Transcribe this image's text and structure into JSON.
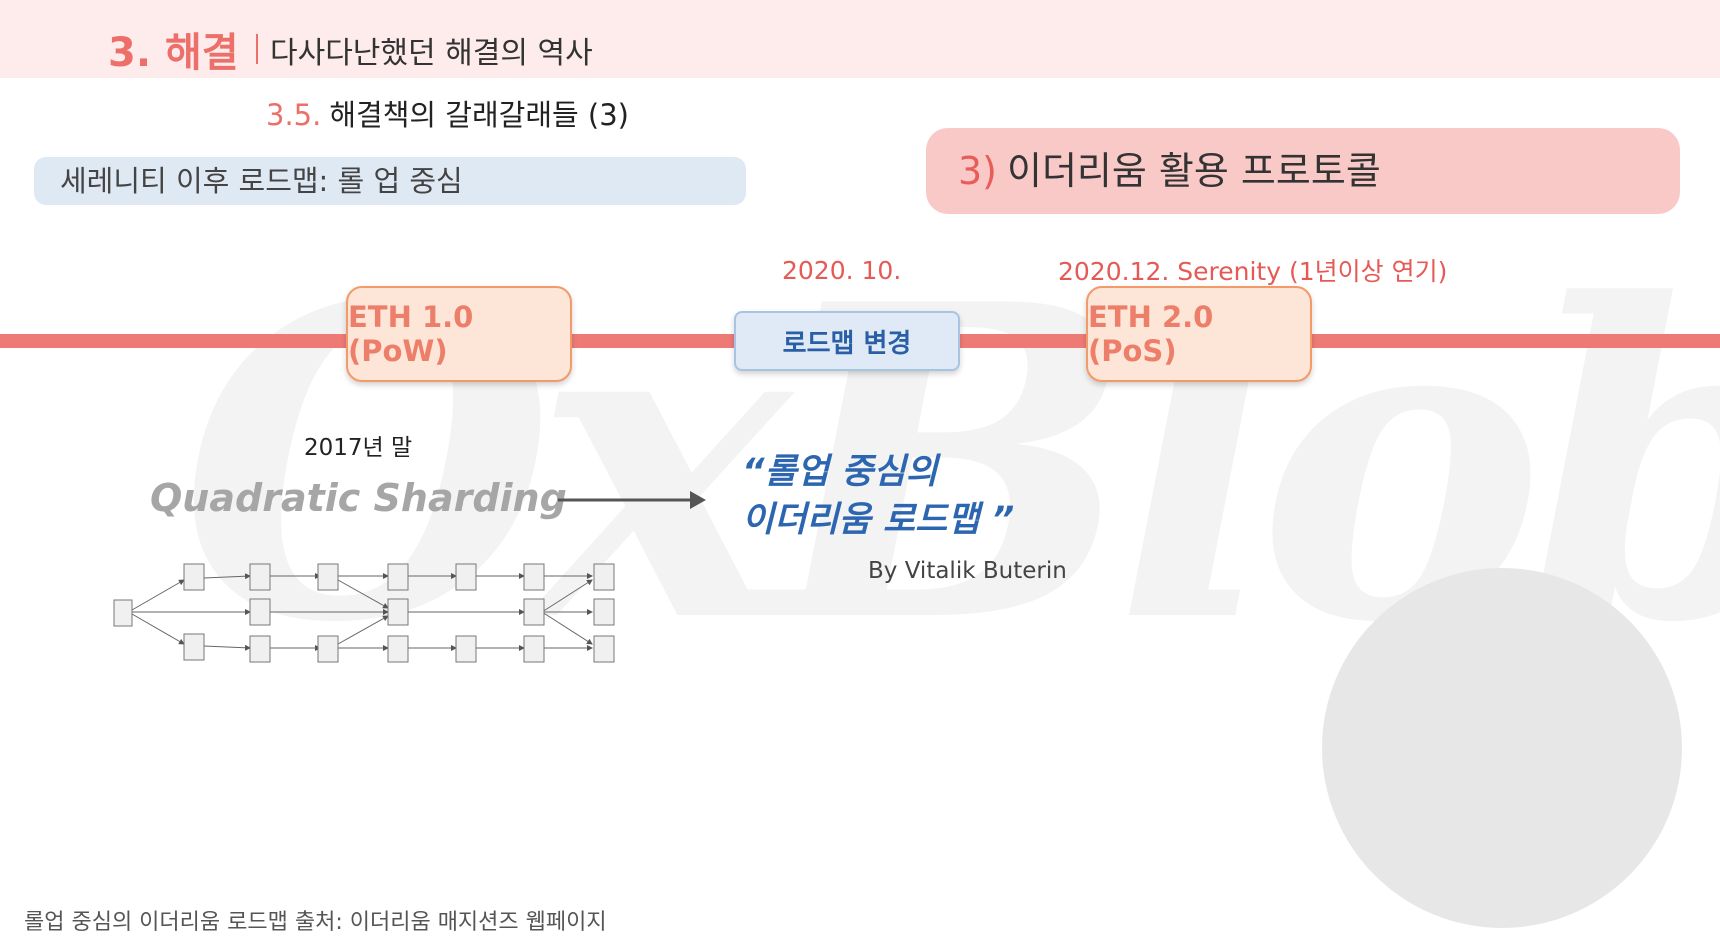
{
  "header": {
    "section_number": "3. 해결",
    "subtitle": "다사다난했던 해결의 역사"
  },
  "subsection": {
    "number": "3.5.",
    "title": "해결책의 갈래갈래들 (3)"
  },
  "roadmap_label": "세레니티 이후 로드맵: 롤 업 중심",
  "protocol": {
    "number": "3)",
    "title": "이더리움 활용 프로토콜"
  },
  "timeline": {
    "eth1": "ETH 1.0 (PoW)",
    "roadmap_change": "로드맵 변경",
    "eth2": "ETH 2.0 (PoS)",
    "date_change": "2020. 10.",
    "date_serenity": "2020.12. Serenity (1년이상 연기)"
  },
  "left": {
    "year": "2017년 말",
    "sharding_title": "Quadratic Sharding"
  },
  "quote": {
    "line1": "“롤업 중심의",
    "line2": "이더리움 로드맵 ”",
    "author": "By Vitalik Buterin"
  },
  "watermark": "OxBlob",
  "source": "롤업 중심의 이더리움 로드맵 출처: 이더리움 매지션즈 웹페이지",
  "colors": {
    "accent": "#ec6f6a",
    "header_band": "#fdeceb",
    "blue": "#2d66b0"
  }
}
